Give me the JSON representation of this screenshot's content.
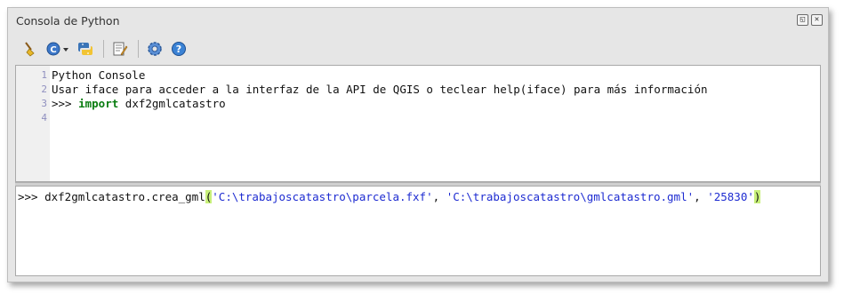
{
  "window": {
    "title": "Consola de Python",
    "float_btn": "◱",
    "close_btn": "✕"
  },
  "toolbar": {
    "items": [
      {
        "icon": "clear-console-icon"
      },
      {
        "icon": "import-class-icon"
      },
      {
        "icon": "python-run-icon"
      },
      {
        "icon": "editor-icon"
      },
      {
        "icon": "settings-icon"
      },
      {
        "icon": "help-icon"
      }
    ]
  },
  "output": {
    "lines": [
      {
        "num": "1",
        "text": "Python Console"
      },
      {
        "num": "2",
        "text": "Usar iface para acceder a la interfaz de la API de QGIS o teclear help(iface) para más información"
      },
      {
        "num": "3",
        "prompt": ">>> ",
        "keyword": "import",
        "rest": " dxf2gmlcatastro"
      },
      {
        "num": "4",
        "text": ""
      }
    ]
  },
  "input": {
    "prompt": ">>> ",
    "call": "dxf2gmlcatastro.crea_gml",
    "open_paren": "(",
    "arg1": "'C:\\trabajoscatastro\\parcela.fxf'",
    "sep1": ", ",
    "arg2": "'C:\\trabajoscatastro\\gmlcatastro.gml'",
    "sep2": ", ",
    "arg3": "'25830'",
    "close_paren": ")"
  },
  "colors": {
    "keyword": "#0a7d11",
    "string": "#1d2bd1",
    "brace_match": "#c8f07a",
    "line_number": "#8f8fbf"
  }
}
